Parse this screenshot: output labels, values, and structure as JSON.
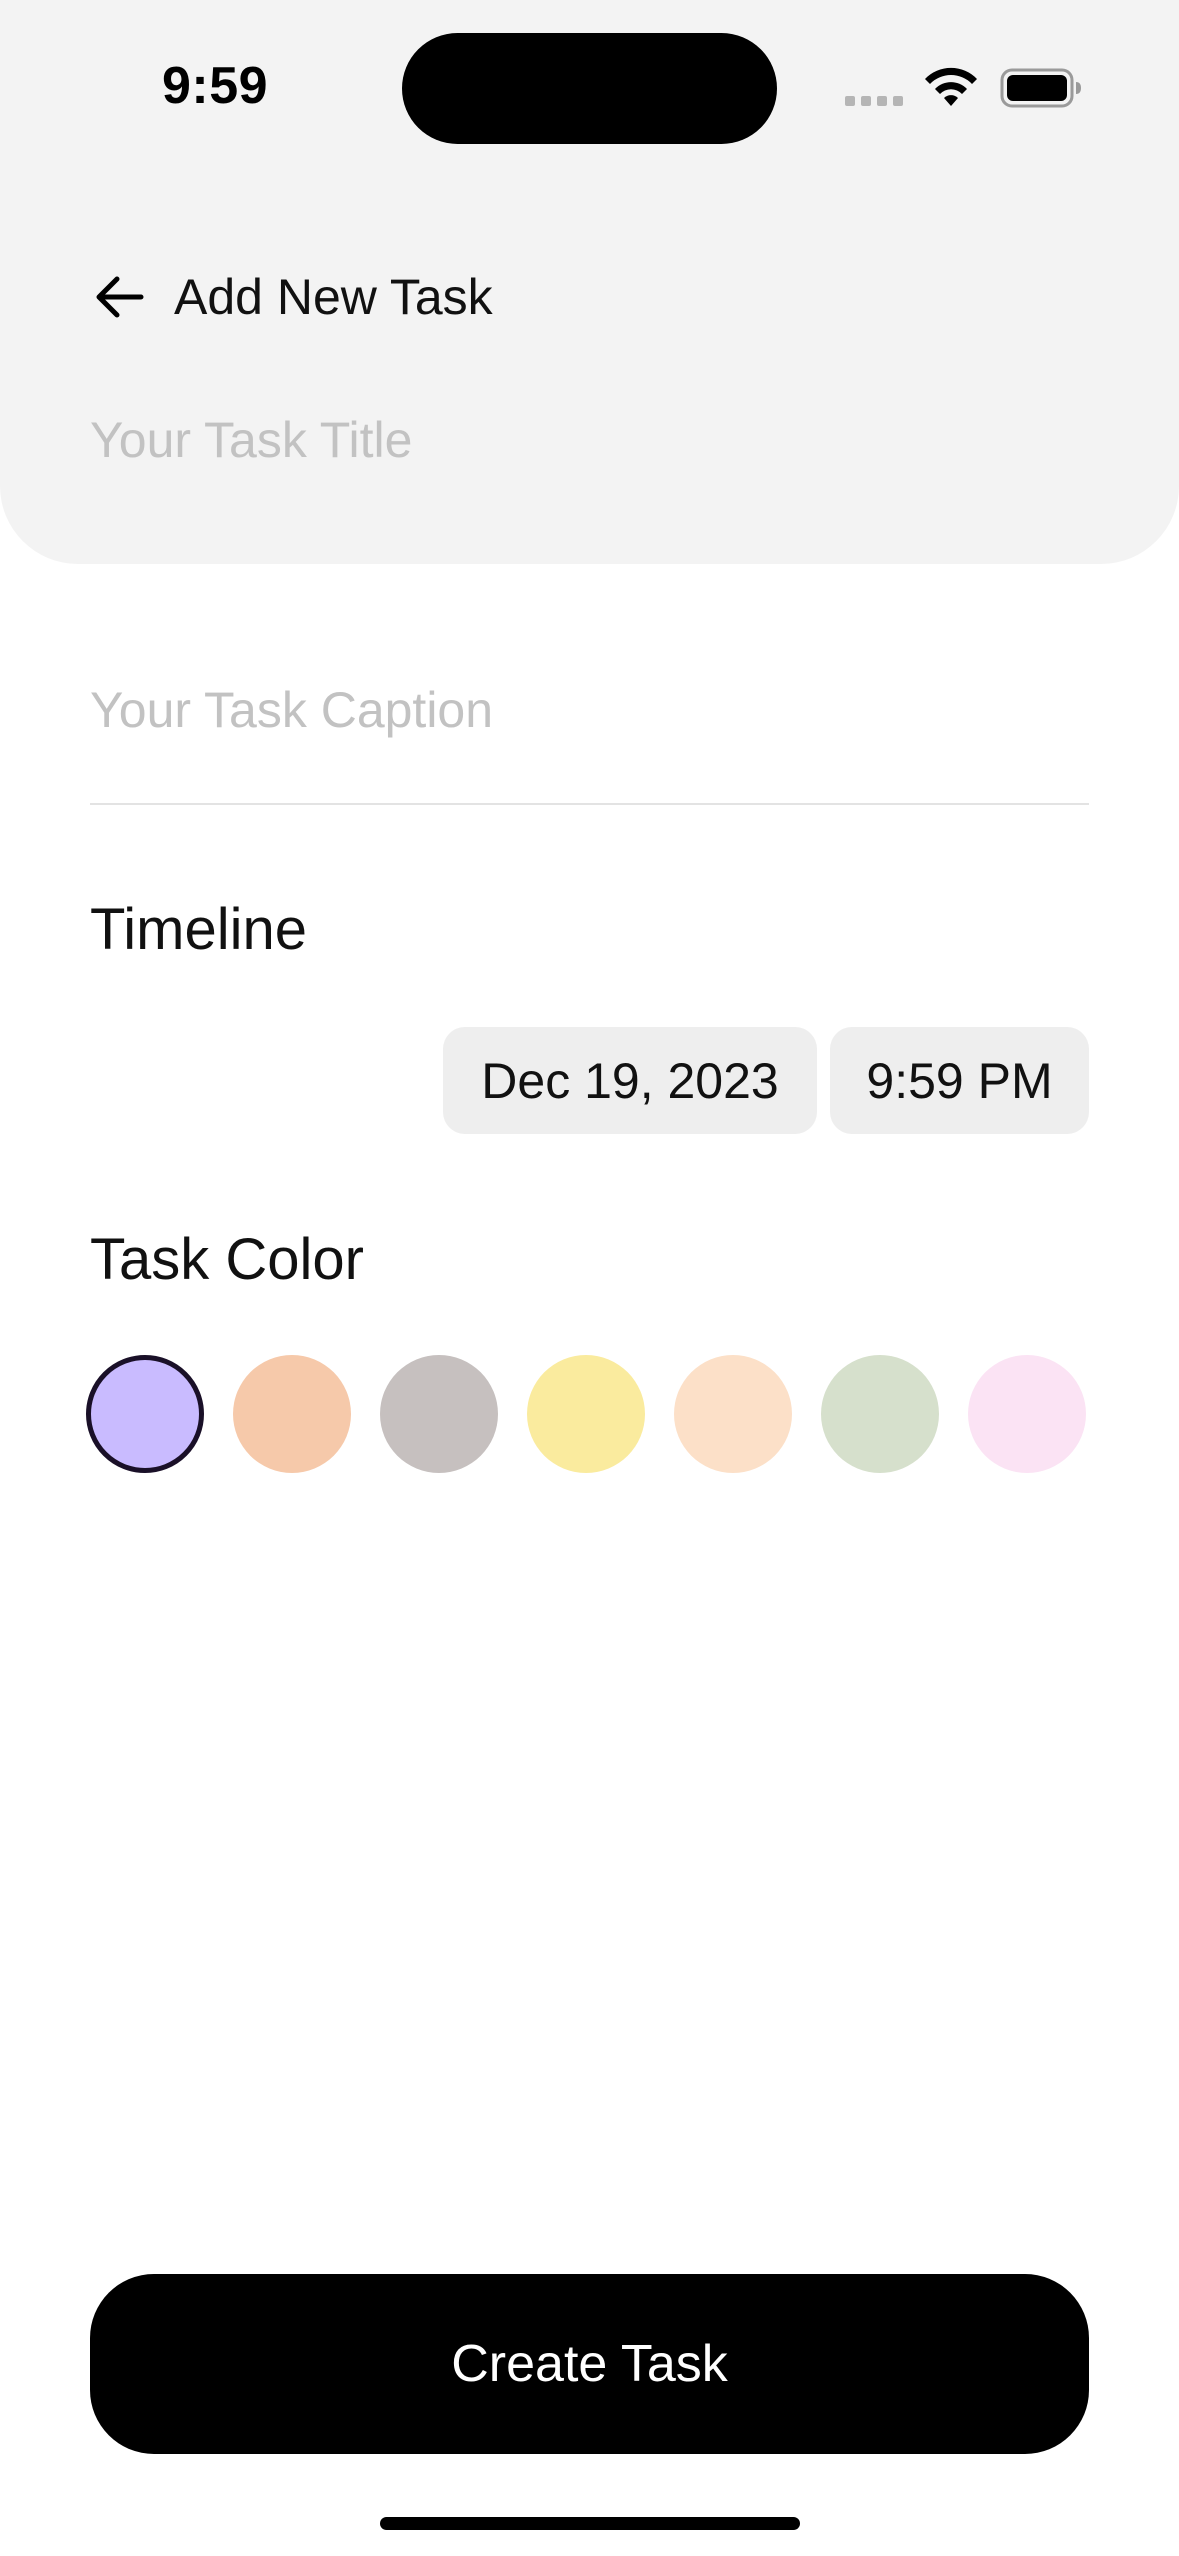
{
  "status_bar": {
    "time": "9:59"
  },
  "header": {
    "back_icon": "arrow-left-icon",
    "title": "Add New Task",
    "task_title_placeholder": "Your Task Title",
    "task_title_value": ""
  },
  "form": {
    "caption_placeholder": "Your Task Caption",
    "caption_value": "",
    "timeline_label": "Timeline",
    "date": "Dec 19, 2023",
    "time": "9:59 PM",
    "task_color_label": "Task Color",
    "colors": [
      {
        "hex": "#c9bbff",
        "selected": true
      },
      {
        "hex": "#f6c9aa",
        "selected": false
      },
      {
        "hex": "#c6c0bf",
        "selected": false
      },
      {
        "hex": "#faeb9e",
        "selected": false
      },
      {
        "hex": "#fce0c8",
        "selected": false
      },
      {
        "hex": "#d6e0cc",
        "selected": false
      },
      {
        "hex": "#fbe3f4",
        "selected": false
      }
    ]
  },
  "footer": {
    "create_button_label": "Create Task"
  }
}
